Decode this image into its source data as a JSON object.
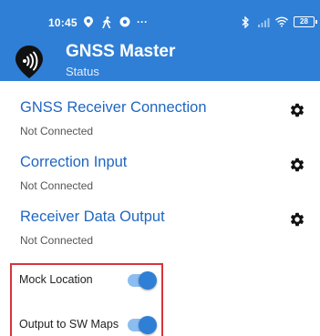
{
  "status_bar": {
    "time": "10:45",
    "dots": "···",
    "battery": "28"
  },
  "app_bar": {
    "title": "GNSS Master",
    "subtitle": "Status"
  },
  "sections": [
    {
      "title": "GNSS Receiver Connection",
      "status": "Not Connected"
    },
    {
      "title": "Correction Input",
      "status": "Not Connected"
    },
    {
      "title": "Receiver Data Output",
      "status": "Not Connected"
    }
  ],
  "toggles": [
    {
      "label": "Mock Location",
      "on": true
    },
    {
      "label": "Output to SW Maps",
      "on": true
    }
  ],
  "colors": {
    "primary": "#2f7fd6",
    "highlight_box": "#d8343b"
  }
}
